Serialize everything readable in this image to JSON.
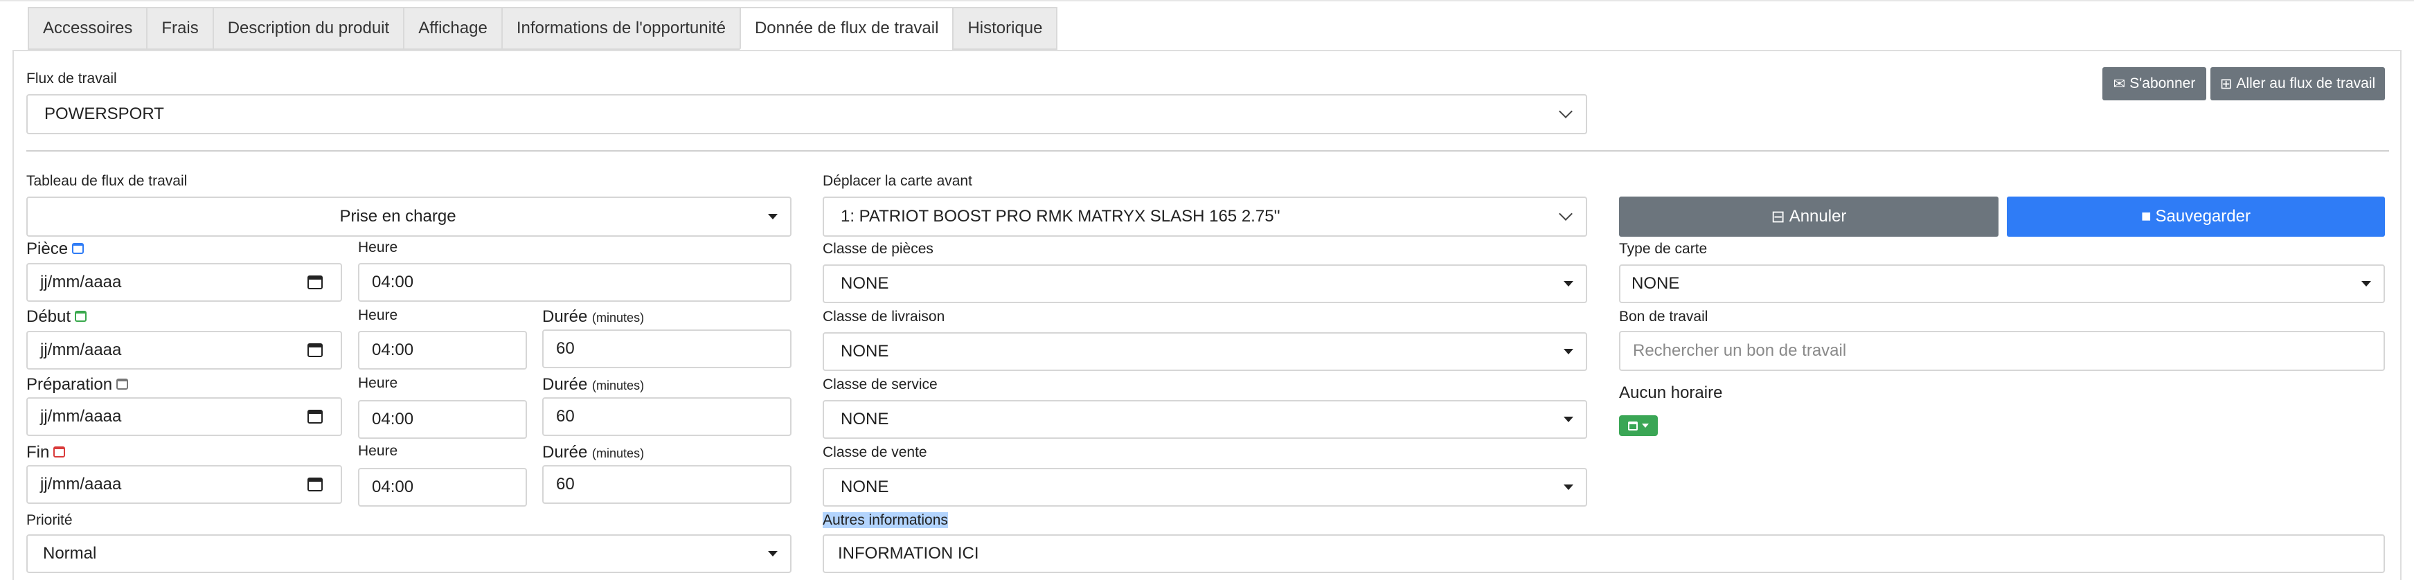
{
  "tabs": [
    "Accessoires",
    "Frais",
    "Description du produit",
    "Affichage",
    "Informations de l'opportunité",
    "Donnée de flux de travail",
    "Historique"
  ],
  "active_tab": "Donnée de flux de travail",
  "workflow": {
    "label": "Flux de travail",
    "value": "POWERSPORT"
  },
  "header_buttons": {
    "subscribe": "S'abonner",
    "goto": "Aller au flux de travail"
  },
  "board": {
    "label": "Tableau de flux de travail",
    "value": "Prise en charge"
  },
  "move_card": {
    "label": "Déplacer la carte avant",
    "value": "1: PATRIOT BOOST PRO RMK MATRYX SLASH 165 2.75''"
  },
  "actions": {
    "cancel": "Annuler",
    "save": "Sauvegarder"
  },
  "dates": [
    {
      "label": "Pièce",
      "date_ph": "jj/mm/aaaa",
      "time_label": "Heure",
      "time": "04:00",
      "has_duration": false,
      "icon_color": "blue"
    },
    {
      "label": "Début",
      "date_ph": "jj/mm/aaaa",
      "time_label": "Heure",
      "time": "04:00",
      "has_duration": true,
      "duration_label": "Durée",
      "duration_unit": "(minutes)",
      "duration": "60",
      "icon_color": "green"
    },
    {
      "label": "Préparation",
      "date_ph": "jj/mm/aaaa",
      "time_label": "Heure",
      "time": "04:00",
      "has_duration": true,
      "duration_label": "Durée",
      "duration_unit": "(minutes)",
      "duration": "60",
      "icon_color": "gray"
    },
    {
      "label": "Fin",
      "date_ph": "jj/mm/aaaa",
      "time_label": "Heure",
      "time": "04:00",
      "has_duration": true,
      "duration_label": "Durée",
      "duration_unit": "(minutes)",
      "duration": "60",
      "icon_color": "red"
    }
  ],
  "classes": [
    {
      "label": "Classe de pièces",
      "value": "NONE"
    },
    {
      "label": "Classe de livraison",
      "value": "NONE"
    },
    {
      "label": "Classe de service",
      "value": "NONE"
    },
    {
      "label": "Classe de vente",
      "value": "NONE"
    }
  ],
  "card_type": {
    "label": "Type de carte",
    "value": "NONE"
  },
  "work_order": {
    "label": "Bon de travail",
    "placeholder": "Rechercher un bon de travail"
  },
  "schedule": {
    "label": "Aucun horaire"
  },
  "priority": {
    "label": "Priorité",
    "value": "Normal"
  },
  "other_info": {
    "label": "Autres informations",
    "value": "INFORMATION ICI"
  },
  "colors": {
    "blue": "#2f7cf6",
    "gray_btn": "#6c757d",
    "green": "#3aa655",
    "red": "#d93b3b"
  }
}
